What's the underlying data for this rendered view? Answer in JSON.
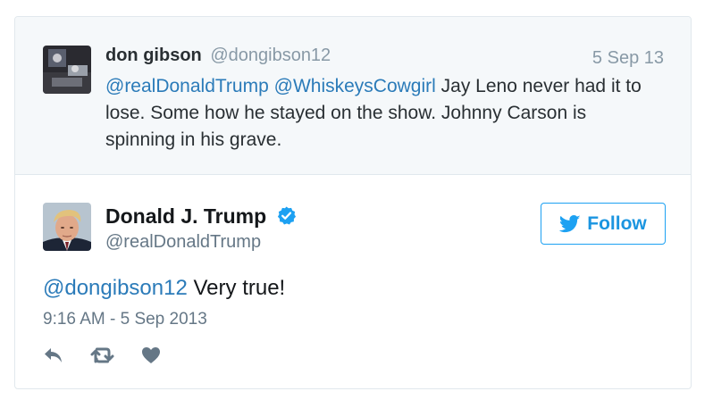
{
  "parent_tweet": {
    "name": "don gibson",
    "handle": "@dongibson12",
    "date": "5 Sep 13",
    "mention1": "@realDonaldTrump",
    "mention2": "@WhiskeysCowgirl",
    "text": " Jay Leno never had it to lose. Some how he stayed on the show. Johnny Carson is spinning in his grave."
  },
  "tweet": {
    "name": "Donald J. Trump",
    "handle": "@realDonaldTrump",
    "verified": true,
    "follow_label": "Follow",
    "mention": "@dongibson12",
    "text": " Very true!",
    "timestamp": "9:16 AM - 5 Sep 2013"
  },
  "actions": [
    {
      "icon": "reply-icon"
    },
    {
      "icon": "retweet-icon"
    },
    {
      "icon": "heart-icon"
    }
  ],
  "colors": {
    "link": "#2b7bb9",
    "brand": "#1da1f2",
    "muted": "#8899a6",
    "parent_bg": "#f5f8fa"
  }
}
